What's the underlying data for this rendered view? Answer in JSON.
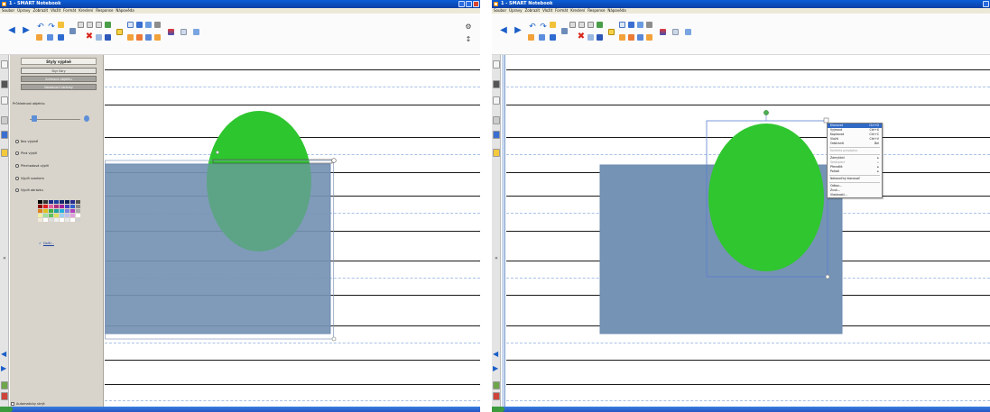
{
  "screens": [
    {
      "id": "left",
      "window_title": "1 - SMART Notebook",
      "menus": [
        "Soubor",
        "Úpravy",
        "Zobrazit",
        "Vložit",
        "Formát",
        "Kreslení",
        "Response",
        "Nápověda"
      ],
      "properties_panel": {
        "title": "Styly výplně",
        "sections": [
          "Styl čáry",
          "Animace objektu",
          "Nastavení stránky"
        ],
        "transparency_label": "Průhlednost objektu:",
        "fill_options": [
          "Bez výplně",
          "Plná výplň",
          "Přechodová výplň",
          "Výplň vzorkem",
          "Výplň obrázku"
        ],
        "more_colors_label": "Další...",
        "auto_hide_label": "Automaticky skrýt"
      }
    },
    {
      "id": "right",
      "window_title": "1 - SMART Notebook",
      "menus": [
        "Soubor",
        "Úpravy",
        "Zobrazit",
        "Vložit",
        "Formát",
        "Kreslení",
        "Response",
        "Nápověda"
      ],
      "context_menu": {
        "items": [
          {
            "label": "Klonovat",
            "shortcut": "Ctrl+D",
            "highlighted": true
          },
          {
            "label": "Vyjmout",
            "shortcut": "Ctrl+X"
          },
          {
            "label": "Kopírovat",
            "shortcut": "Ctrl+C"
          },
          {
            "label": "Vložit",
            "shortcut": "Ctrl+V"
          },
          {
            "label": "Odstranit",
            "shortcut": "Del"
          },
          {
            "separator": true
          },
          {
            "label": "Kontrola pravopisu",
            "disabled": true
          },
          {
            "separator": true
          },
          {
            "label": "Zamykání",
            "submenu": true
          },
          {
            "label": "Seskupení",
            "submenu": true,
            "disabled": true
          },
          {
            "label": "Převrátit",
            "submenu": true
          },
          {
            "label": "Pořadí",
            "submenu": true
          },
          {
            "separator": true
          },
          {
            "label": "Nekonečný klonovač"
          },
          {
            "separator": true
          },
          {
            "label": "Odkaz..."
          },
          {
            "label": "Zvuk..."
          },
          {
            "label": "Vlastnosti..."
          }
        ]
      }
    }
  ],
  "colors": {
    "shape_green": "#2fc62f",
    "rect_fill": "#7593b4",
    "ruled_line": "#1a1a1a",
    "dashed_line": "#a9c2e6",
    "titlebar": "#0b4fc0",
    "selection": "#5a7fd0"
  }
}
